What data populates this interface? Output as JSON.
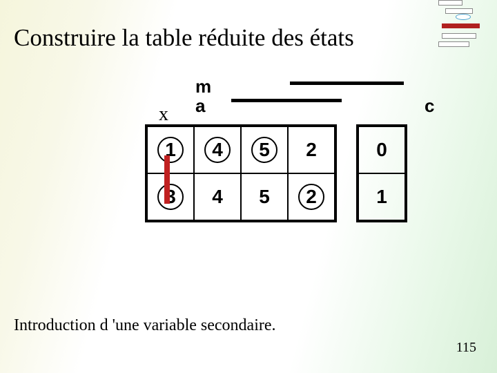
{
  "title": "Construire la table réduite des états",
  "labels": {
    "m": "m",
    "a": "a",
    "x": "x",
    "c": "c"
  },
  "table_main": {
    "rows": [
      [
        {
          "value": "1",
          "circled": true
        },
        {
          "value": "4",
          "circled": true
        },
        {
          "value": "5",
          "circled": true
        },
        {
          "value": "2",
          "circled": false
        }
      ],
      [
        {
          "value": "3",
          "circled": true
        },
        {
          "value": "4",
          "circled": false
        },
        {
          "value": "5",
          "circled": false
        },
        {
          "value": "2",
          "circled": true
        }
      ]
    ]
  },
  "table_c": {
    "rows": [
      "0",
      "1"
    ]
  },
  "footer_text": "Introduction d 'une variable secondaire.",
  "page_number": "115"
}
